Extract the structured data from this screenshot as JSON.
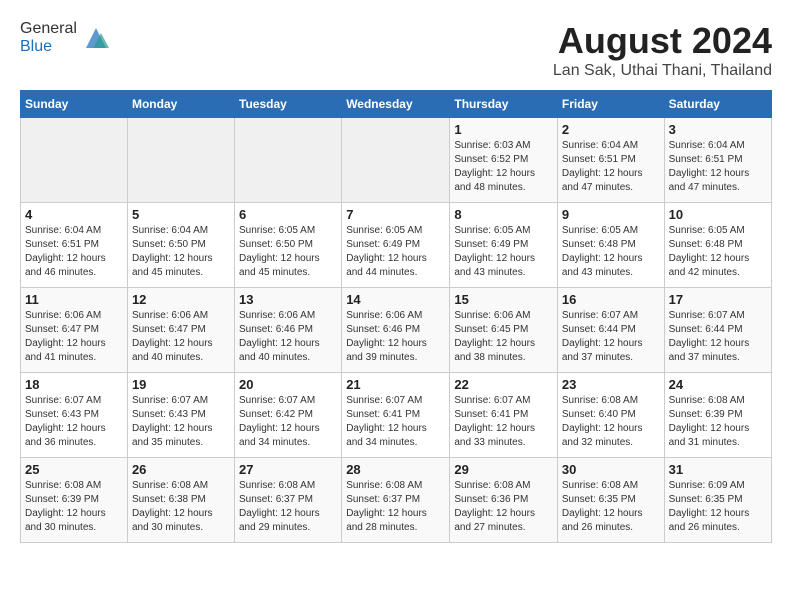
{
  "header": {
    "logo_line1": "General",
    "logo_line2": "Blue",
    "month_year": "August 2024",
    "location": "Lan Sak, Uthai Thani, Thailand"
  },
  "days_of_week": [
    "Sunday",
    "Monday",
    "Tuesday",
    "Wednesday",
    "Thursday",
    "Friday",
    "Saturday"
  ],
  "weeks": [
    [
      {
        "day": "",
        "empty": true
      },
      {
        "day": "",
        "empty": true
      },
      {
        "day": "",
        "empty": true
      },
      {
        "day": "",
        "empty": true
      },
      {
        "day": "1",
        "sunrise": "6:03 AM",
        "sunset": "6:52 PM",
        "daylight": "12 hours and 48 minutes."
      },
      {
        "day": "2",
        "sunrise": "6:04 AM",
        "sunset": "6:51 PM",
        "daylight": "12 hours and 47 minutes."
      },
      {
        "day": "3",
        "sunrise": "6:04 AM",
        "sunset": "6:51 PM",
        "daylight": "12 hours and 47 minutes."
      }
    ],
    [
      {
        "day": "4",
        "sunrise": "6:04 AM",
        "sunset": "6:51 PM",
        "daylight": "12 hours and 46 minutes."
      },
      {
        "day": "5",
        "sunrise": "6:04 AM",
        "sunset": "6:50 PM",
        "daylight": "12 hours and 45 minutes."
      },
      {
        "day": "6",
        "sunrise": "6:05 AM",
        "sunset": "6:50 PM",
        "daylight": "12 hours and 45 minutes."
      },
      {
        "day": "7",
        "sunrise": "6:05 AM",
        "sunset": "6:49 PM",
        "daylight": "12 hours and 44 minutes."
      },
      {
        "day": "8",
        "sunrise": "6:05 AM",
        "sunset": "6:49 PM",
        "daylight": "12 hours and 43 minutes."
      },
      {
        "day": "9",
        "sunrise": "6:05 AM",
        "sunset": "6:48 PM",
        "daylight": "12 hours and 43 minutes."
      },
      {
        "day": "10",
        "sunrise": "6:05 AM",
        "sunset": "6:48 PM",
        "daylight": "12 hours and 42 minutes."
      }
    ],
    [
      {
        "day": "11",
        "sunrise": "6:06 AM",
        "sunset": "6:47 PM",
        "daylight": "12 hours and 41 minutes."
      },
      {
        "day": "12",
        "sunrise": "6:06 AM",
        "sunset": "6:47 PM",
        "daylight": "12 hours and 40 minutes."
      },
      {
        "day": "13",
        "sunrise": "6:06 AM",
        "sunset": "6:46 PM",
        "daylight": "12 hours and 40 minutes."
      },
      {
        "day": "14",
        "sunrise": "6:06 AM",
        "sunset": "6:46 PM",
        "daylight": "12 hours and 39 minutes."
      },
      {
        "day": "15",
        "sunrise": "6:06 AM",
        "sunset": "6:45 PM",
        "daylight": "12 hours and 38 minutes."
      },
      {
        "day": "16",
        "sunrise": "6:07 AM",
        "sunset": "6:44 PM",
        "daylight": "12 hours and 37 minutes."
      },
      {
        "day": "17",
        "sunrise": "6:07 AM",
        "sunset": "6:44 PM",
        "daylight": "12 hours and 37 minutes."
      }
    ],
    [
      {
        "day": "18",
        "sunrise": "6:07 AM",
        "sunset": "6:43 PM",
        "daylight": "12 hours and 36 minutes."
      },
      {
        "day": "19",
        "sunrise": "6:07 AM",
        "sunset": "6:43 PM",
        "daylight": "12 hours and 35 minutes."
      },
      {
        "day": "20",
        "sunrise": "6:07 AM",
        "sunset": "6:42 PM",
        "daylight": "12 hours and 34 minutes."
      },
      {
        "day": "21",
        "sunrise": "6:07 AM",
        "sunset": "6:41 PM",
        "daylight": "12 hours and 34 minutes."
      },
      {
        "day": "22",
        "sunrise": "6:07 AM",
        "sunset": "6:41 PM",
        "daylight": "12 hours and 33 minutes."
      },
      {
        "day": "23",
        "sunrise": "6:08 AM",
        "sunset": "6:40 PM",
        "daylight": "12 hours and 32 minutes."
      },
      {
        "day": "24",
        "sunrise": "6:08 AM",
        "sunset": "6:39 PM",
        "daylight": "12 hours and 31 minutes."
      }
    ],
    [
      {
        "day": "25",
        "sunrise": "6:08 AM",
        "sunset": "6:39 PM",
        "daylight": "12 hours and 30 minutes."
      },
      {
        "day": "26",
        "sunrise": "6:08 AM",
        "sunset": "6:38 PM",
        "daylight": "12 hours and 30 minutes."
      },
      {
        "day": "27",
        "sunrise": "6:08 AM",
        "sunset": "6:37 PM",
        "daylight": "12 hours and 29 minutes."
      },
      {
        "day": "28",
        "sunrise": "6:08 AM",
        "sunset": "6:37 PM",
        "daylight": "12 hours and 28 minutes."
      },
      {
        "day": "29",
        "sunrise": "6:08 AM",
        "sunset": "6:36 PM",
        "daylight": "12 hours and 27 minutes."
      },
      {
        "day": "30",
        "sunrise": "6:08 AM",
        "sunset": "6:35 PM",
        "daylight": "12 hours and 26 minutes."
      },
      {
        "day": "31",
        "sunrise": "6:09 AM",
        "sunset": "6:35 PM",
        "daylight": "12 hours and 26 minutes."
      }
    ]
  ]
}
